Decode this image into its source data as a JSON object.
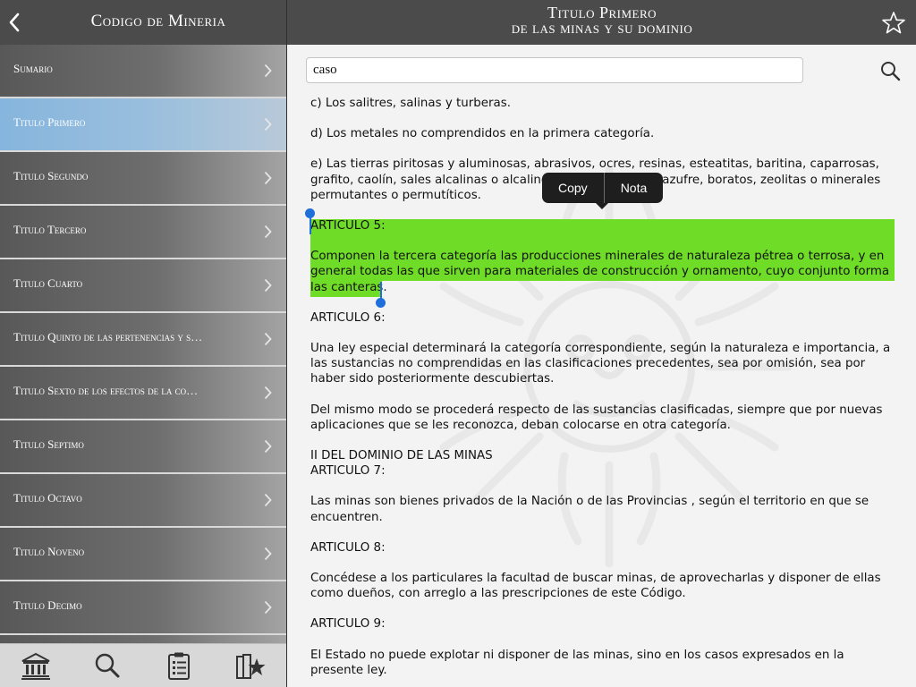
{
  "left": {
    "title": "Codigo de Mineria",
    "items": [
      {
        "label": "Sumario"
      },
      {
        "label": "Titulo Primero"
      },
      {
        "label": "Titulo Segundo"
      },
      {
        "label": "Titulo Tercero"
      },
      {
        "label": "Titulo Cuarto"
      },
      {
        "label": "Titulo Quinto de las pertenencias y s…"
      },
      {
        "label": "Titulo Sexto de los efectos de la co…"
      },
      {
        "label": "Titulo Septimo"
      },
      {
        "label": "Titulo Octavo"
      },
      {
        "label": "Titulo Noveno"
      },
      {
        "label": "Titulo Decimo"
      }
    ],
    "selected_index": 1
  },
  "right": {
    "title_line1": "Titulo Primero",
    "title_line2": "de las minas y su dominio"
  },
  "search": {
    "value": "caso"
  },
  "context_menu": {
    "copy": "Copy",
    "note": "Nota"
  },
  "document": {
    "p1": "c) Los salitres, salinas y turberas.",
    "p2": "d) Los metales no comprendidos en la primera categoría.",
    "p3": "e) Las tierras piritosas y aluminosas, abrasivos, ocres, resinas, esteatitas, baritina, caparrosas, grafito, caolín, sales alcalinas o alcalino terrosas, nitratos, azufre, boratos, zeolitas o minerales permutantes o permutíticos.",
    "a5_heading": "ARTICULO 5:",
    "a5_text": "Componen la tercera categoría las producciones minerales de naturaleza pétrea o terrosa, y en general todas las que sirven para materiales de construcción y ornamento, cuyo conjunto forma las canteras.",
    "a6_heading": "ARTICULO 6:",
    "a6_text1": "Una ley especial determinará la categoría correspondiente, según la naturaleza e importancia, a las sustancias no comprendidas en las clasificaciones precedentes, sea por omisión, sea por haber sido posteriormente descubiertas.",
    "a6_text2": "Del mismo modo se procederá respecto de las sustancias clasificadas, siempre que por nuevas aplicaciones que se les reconozca, deban colocarse en otra categoría.",
    "section2": "II DEL DOMINIO DE LAS MINAS",
    "a7_heading": "ARTICULO 7:",
    "a7_text": "Las minas son bienes privados de la Nación o de las Provincias , según el territorio en que se encuentren.",
    "a8_heading": "ARTICULO 8:",
    "a8_text": "Concédese a los particulares la facultad de buscar minas, de aprovecharlas y disponer de ellas como dueños, con arreglo a las prescripciones de este Código.",
    "a9_heading": "ARTICULO 9:",
    "a9_text": "El Estado no puede explotar ni disponer de las minas, sino en los casos expresados en la presente ley."
  },
  "colors": {
    "highlight": "#6fdc27",
    "selected_item": "#86b5dd",
    "header": "#4b4b4b",
    "selection_handle": "#1e6fd9"
  },
  "icons": {
    "back": "chevron-left-icon",
    "star": "star-icon",
    "search": "search-icon",
    "tab1": "bank-building-icon",
    "tab2": "search-icon",
    "tab3": "clipboard-list-icon",
    "tab4": "book-star-icon"
  }
}
